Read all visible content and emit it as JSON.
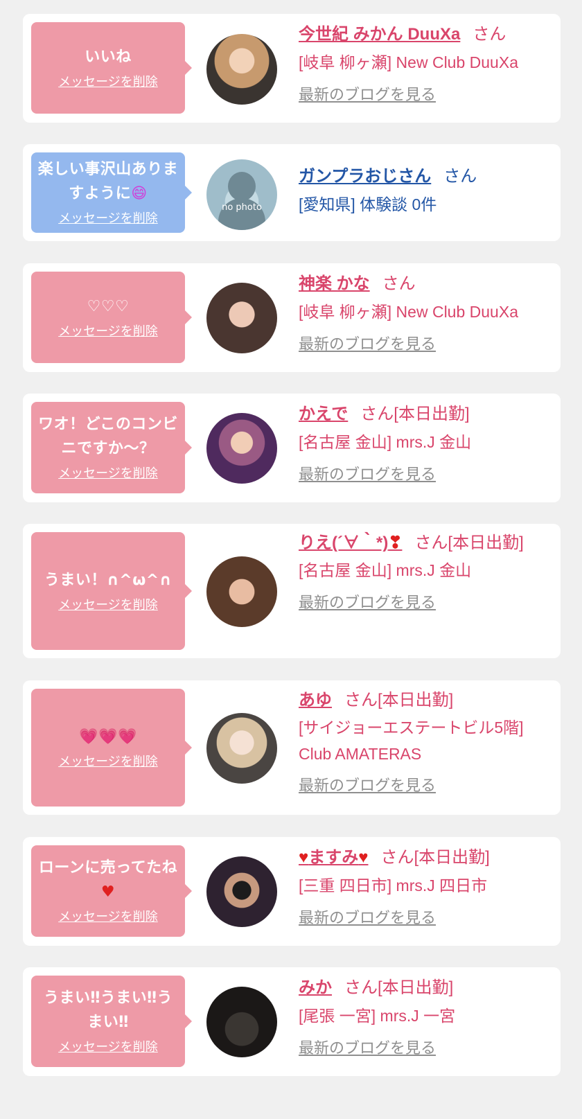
{
  "messages": [
    {
      "bubble_text": "いいね",
      "delete_label": "メッセージを削除",
      "name": "今世紀 みかん DuuXa",
      "honorific": "さん",
      "location": "[岐阜 柳ヶ瀬] New Club DuuXa",
      "blog_link": "最新のブログを見る"
    },
    {
      "bubble_text": "楽しい事沢山ありますように",
      "bubble_emoji": "😄",
      "delete_label": "メッセージを削除",
      "avatar_label": "no photo",
      "name": "ガンプラおじさん",
      "honorific": "さん",
      "location": "[愛知県] 体験談 0件"
    },
    {
      "bubble_text": "♡♡♡",
      "delete_label": "メッセージを削除",
      "name": "神楽 かな",
      "honorific": "さん",
      "location": "[岐阜 柳ヶ瀬] New Club DuuXa",
      "blog_link": "最新のブログを見る"
    },
    {
      "bubble_text": "ワオ！どこのコンビニですか～？",
      "delete_label": "メッセージを削除",
      "name": "かえで",
      "honorific": "さん[本日出勤]",
      "location": "[名古屋 金山] mrs.J 金山",
      "blog_link": "最新のブログを見る"
    },
    {
      "bubble_text": "うまい！∩^ω^∩",
      "delete_label": "メッセージを削除",
      "name": "りえ(´∀｀*)",
      "name_suffix_heart": "❣",
      "honorific": "さん[本日出勤]",
      "location": "[名古屋 金山] mrs.J 金山",
      "blog_link": "最新のブログを見る"
    },
    {
      "bubble_text": "💗💗💗",
      "delete_label": "メッセージを削除",
      "name": "あゆ",
      "honorific": "さん[本日出勤]",
      "location": "[サイジョーエステートビル5階] Club AMATERAS",
      "blog_link": "最新のブログを見る"
    },
    {
      "bubble_text": "ローンに売ってたね",
      "bubble_emoji": "♥",
      "delete_label": "メッセージを削除",
      "name_prefix_heart": "♥",
      "name": "ますみ",
      "name_suffix_heart": "♥",
      "honorific": "さん[本日出勤]",
      "location": "[三重 四日市] mrs.J 四日市",
      "blog_link": "最新のブログを見る"
    },
    {
      "bubble_text": "うまい‼うまい‼うまい‼",
      "delete_label": "メッセージを削除",
      "name": "みか",
      "honorific": "さん[本日出勤]",
      "location": "[尾張 一宮] mrs.J 一宮",
      "blog_link": "最新のブログを見る"
    }
  ],
  "colors": {
    "page_bg": "#f0f0f0",
    "card_bg": "#ffffff",
    "bubble_pink": "#ee9aa7",
    "bubble_blue": "#94b8ee",
    "cast_name": "#d9456b",
    "user_name": "#2356a6",
    "blog_link": "#8f8f8f"
  }
}
